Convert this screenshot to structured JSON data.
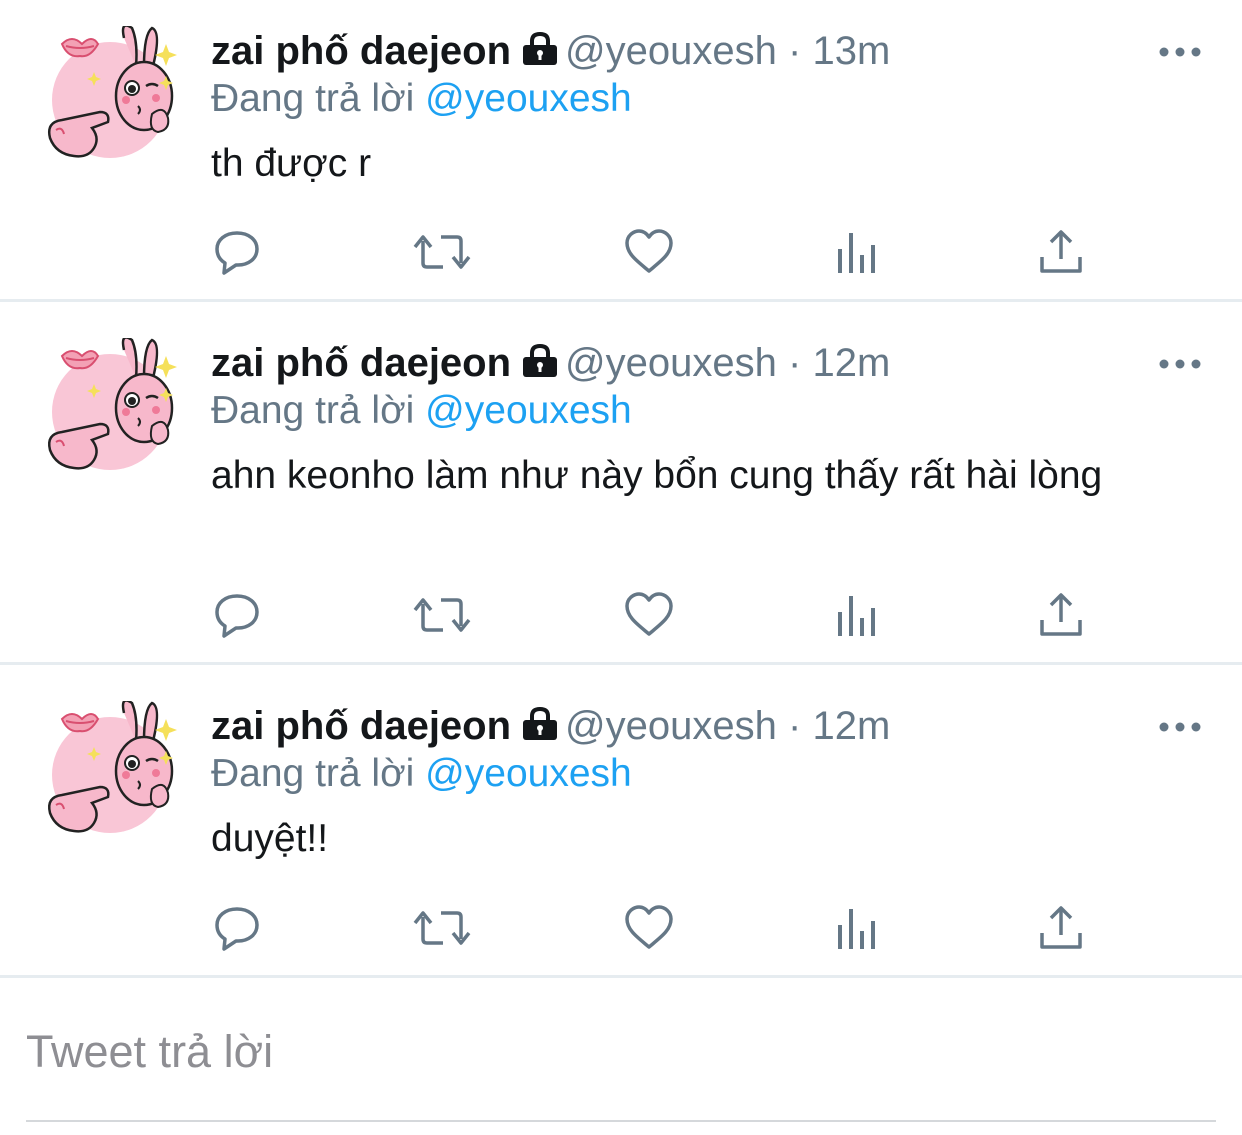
{
  "tweets": [
    {
      "display_name": "zai phố daejeon",
      "handle": "@yeouxesh",
      "separator": "·",
      "time": "13m",
      "replying_prefix": "Đang trả lời",
      "replying_to": "@yeouxesh",
      "text": "th được r"
    },
    {
      "display_name": "zai phố daejeon",
      "handle": "@yeouxesh",
      "separator": "·",
      "time": "12m",
      "replying_prefix": "Đang trả lời",
      "replying_to": "@yeouxesh",
      "text": "ahn keonho làm như này bổn cung thấy rất hài lòng"
    },
    {
      "display_name": "zai phố daejeon",
      "handle": "@yeouxesh",
      "separator": "·",
      "time": "12m",
      "replying_prefix": "Đang trả lời",
      "replying_to": "@yeouxesh",
      "text": "duyệt!!"
    }
  ],
  "icons": {
    "lock": "lock-icon",
    "more": "more-dots-icon",
    "reply": "reply-icon",
    "retweet": "retweet-icon",
    "like": "like-icon",
    "analytics": "analytics-icon",
    "share": "share-icon"
  },
  "composer": {
    "placeholder": "Tweet trả lời"
  },
  "colors": {
    "mention": "#1da1f2",
    "secondary_text": "#657786",
    "icon": "#657786",
    "divider": "#e6ecf0",
    "avatar_pink": "#f9c6d6"
  }
}
